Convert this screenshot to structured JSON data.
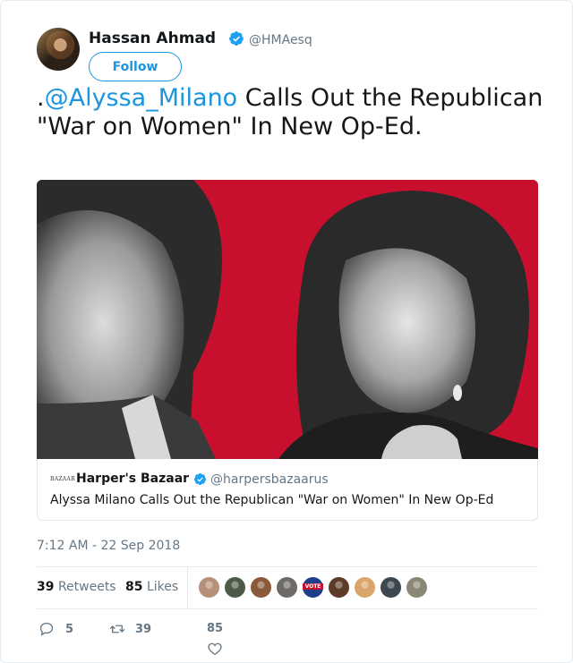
{
  "tweet": {
    "author_name": "Hassan Ahmad",
    "author_handle": "@HMAesq",
    "follow_label": "Follow",
    "text_prefix": ".",
    "mention": "@Alyssa_Milano",
    "text_rest": " Calls Out the Republican \"War on Women\" In New Op-Ed.",
    "timestamp": "7:12 AM - 22 Sep 2018"
  },
  "link_card": {
    "logo_text": "BAZAAR",
    "source_name": "Harper's Bazaar",
    "source_handle": "@harpersbazaarus",
    "title": "Alyssa Milano Calls Out the Republican \"War on Women\" In New Op-Ed"
  },
  "stats": {
    "retweets_count": "39",
    "retweets_label": "Retweets",
    "likes_count": "85",
    "likes_label": "Likes"
  },
  "likers": [
    {
      "name": "liker-1",
      "color": "#b7907a"
    },
    {
      "name": "liker-2",
      "color": "#4d5a48"
    },
    {
      "name": "liker-3",
      "color": "#8a5a3a"
    },
    {
      "name": "liker-4",
      "color": "#6d6a67"
    },
    {
      "name": "liker-5",
      "color": "#1f3e8a",
      "text": "VOTE"
    },
    {
      "name": "liker-6",
      "color": "#5e3a28"
    },
    {
      "name": "liker-7",
      "color": "#d9a56a"
    },
    {
      "name": "liker-8",
      "color": "#3d4750"
    },
    {
      "name": "liker-9",
      "color": "#8b8777"
    }
  ],
  "actions": {
    "reply_count": "5",
    "retweet_count": "39",
    "like_count": "85"
  },
  "colors": {
    "accent": "#1b95e0",
    "media_background": "#c8102e",
    "muted": "#657786"
  }
}
